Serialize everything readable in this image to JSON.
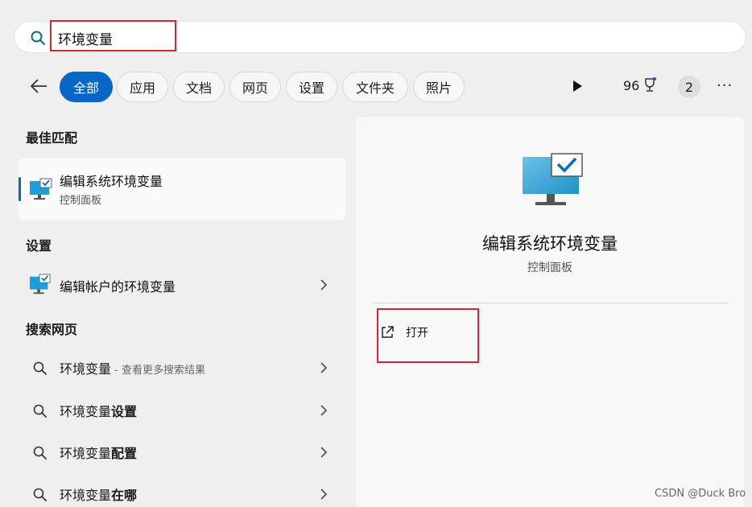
{
  "search": {
    "value": "环境变量"
  },
  "filters": {
    "back_label": "←",
    "chips": [
      "全部",
      "应用",
      "文档",
      "网页",
      "设置",
      "文件夹",
      "照片"
    ],
    "points": "96",
    "notification_count": "2",
    "more_label": "···"
  },
  "best_match": {
    "heading": "最佳匹配",
    "title": "编辑系统环境变量",
    "subtitle": "控制面板"
  },
  "settings": {
    "heading": "设置",
    "item": "编辑帐户的环境变量"
  },
  "web_search": {
    "heading": "搜索网页",
    "items": [
      {
        "prefix": "环境变量",
        "bold": "",
        "hint": " - 查看更多搜索结果"
      },
      {
        "prefix": "环境变量",
        "bold": "设置",
        "hint": ""
      },
      {
        "prefix": "环境变量",
        "bold": "配置",
        "hint": ""
      },
      {
        "prefix": "环境变量",
        "bold": "在哪",
        "hint": ""
      }
    ]
  },
  "detail": {
    "title": "编辑系统环境变量",
    "subtitle": "控制面板",
    "open_label": "打开"
  },
  "watermark": "CSDN @Duck Bro",
  "colors": {
    "accent": "#0867c6",
    "highlight": "#d9252c"
  }
}
